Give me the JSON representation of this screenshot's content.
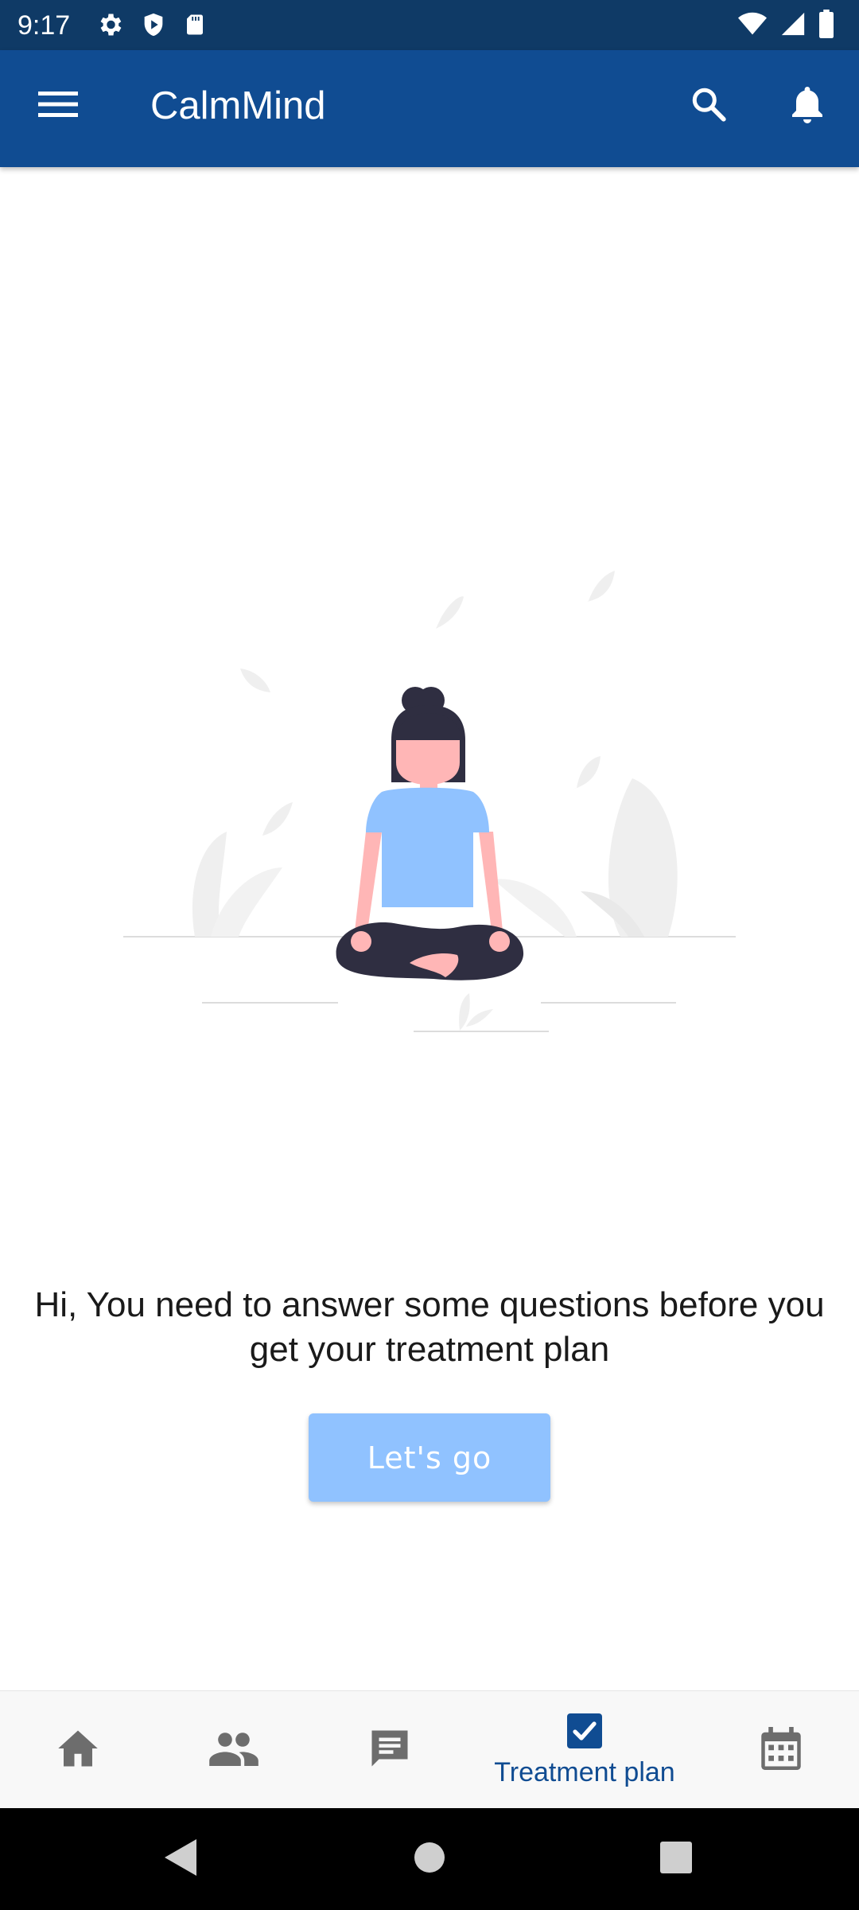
{
  "status_bar": {
    "time": "9:17",
    "left_icons": [
      "gear-icon",
      "shield-play-icon",
      "sd-card-icon"
    ],
    "right_icons": [
      "wifi-icon",
      "cellular-signal-icon",
      "battery-icon"
    ]
  },
  "app_bar": {
    "title": "CalmMind",
    "menu_icon": "hamburger-menu-icon",
    "search_icon": "search-icon",
    "notification_icon": "bell-icon",
    "background_color": "#104c92"
  },
  "main": {
    "illustration": "meditating-woman-illustration",
    "message": "Hi, You need to answer some questions before you get your treatment plan",
    "button_label": "Let's go",
    "button_color": "#90c2ff"
  },
  "bottom_nav": {
    "items": [
      {
        "icon": "home-icon",
        "label": "",
        "active": false
      },
      {
        "icon": "people-icon",
        "label": "",
        "active": false
      },
      {
        "icon": "chat-icon",
        "label": "",
        "active": false
      },
      {
        "icon": "checkbox-icon",
        "label": "Treatment plan",
        "active": true
      },
      {
        "icon": "calendar-icon",
        "label": "",
        "active": false
      }
    ],
    "active_color": "#104c92",
    "inactive_color": "#6d6d6d"
  },
  "system_nav": {
    "buttons": [
      "back-icon",
      "home-circle-icon",
      "recents-icon"
    ]
  }
}
